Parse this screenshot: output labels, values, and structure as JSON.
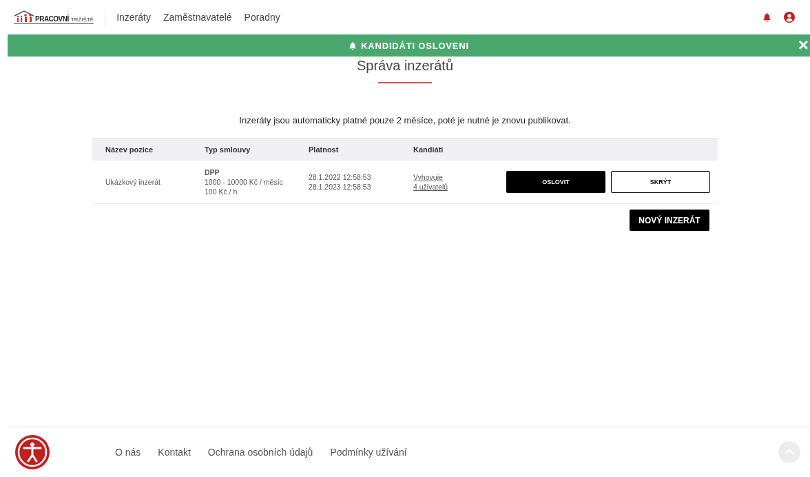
{
  "logo": {
    "word_1": "PRACOVNÍ",
    "word_2": "TRŽIŠTĚ"
  },
  "nav": [
    "Inzeráty",
    "Zaměstnavatelé",
    "Poradny"
  ],
  "banner": {
    "text": "KANDIDÁTI OSLOVENI",
    "close": "×"
  },
  "heading": "Správa inzerátů",
  "notice": "Inzeráty jsou automaticky platné pouze 2 měsíce, poté je nutné je znovu publikovat.",
  "table": {
    "columns": [
      "Název pozice",
      "Typ smlouvy",
      "Platnost",
      "Kandiáti"
    ],
    "rows": [
      {
        "name": "Ukázkový inzerát",
        "contract": "DPP",
        "salary": [
          "1000 - 10000 Kč / měsíc",
          "100 Kč / h"
        ],
        "validity": [
          "28.1.2022 12:58:53",
          "28.1.2023 12:58:53"
        ],
        "candidates": [
          "Vyhovuje",
          "4 uživatelů"
        ],
        "actions": [
          {
            "label": "OSLOVIT",
            "kind": "primary"
          },
          {
            "label": "SKRÝT",
            "kind": "outline"
          }
        ]
      }
    ]
  },
  "new_button": "NOVÝ INZERÁT",
  "footer": {
    "links": [
      "O nás",
      "Kontakt",
      "Ochrana osobních údajů",
      "Podmínky užívání"
    ]
  }
}
